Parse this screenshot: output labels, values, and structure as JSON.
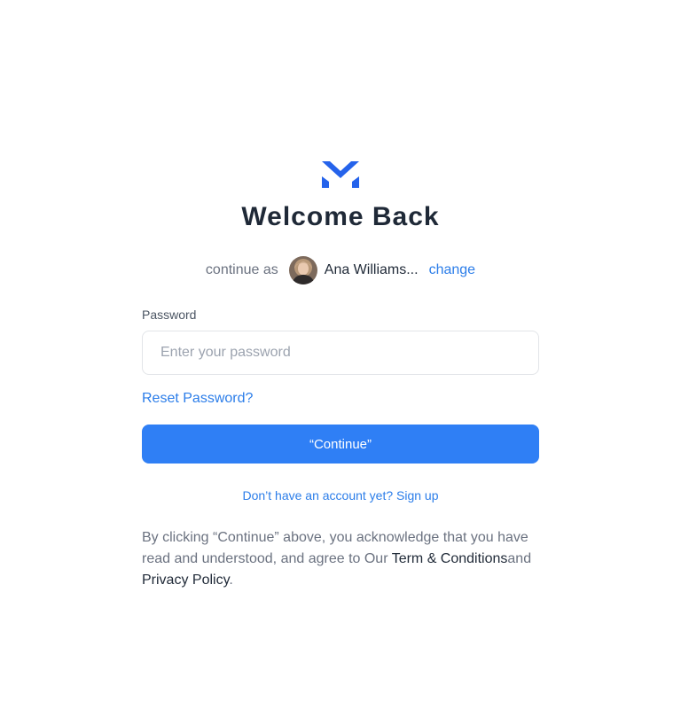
{
  "header": {
    "logo_icon": "m-logo-icon",
    "brand_color": "#2563eb",
    "title": "Welcome Back"
  },
  "account": {
    "continue_label": "continue as",
    "avatar_icon": "user-avatar",
    "user_name": "Ana Williams...",
    "change_label": "change"
  },
  "form": {
    "password_label": "Password",
    "password_value": "",
    "password_placeholder": "Enter your password",
    "reset_label": "Reset Password?",
    "continue_label": "“Continue”",
    "button_color": "#2f7ff5"
  },
  "signup": {
    "text": "Don’t have an account yet? Sign up"
  },
  "legal": {
    "text_before": "By clicking “Continue” above, you acknowledge that you have read and understood, and agree to Our ",
    "terms_label": "Term & Conditions",
    "and_text": "and",
    "privacy_label": "Privacy Policy",
    "period": "."
  },
  "colors": {
    "link": "#2b7de9",
    "heading": "#1f2937",
    "muted": "#6b7280"
  }
}
